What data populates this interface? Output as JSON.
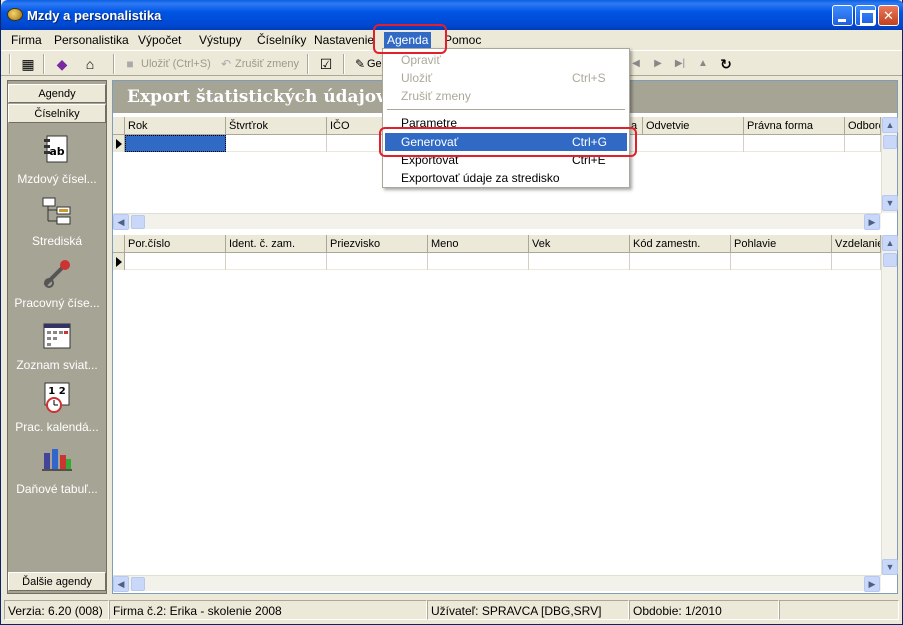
{
  "window": {
    "title": "Mzdy a personalistika"
  },
  "menubar": {
    "items": [
      {
        "label": "Firma"
      },
      {
        "label": "Personalistika"
      },
      {
        "label": "Výpočet"
      },
      {
        "label": "Výstupy"
      },
      {
        "label": "Číselníky"
      },
      {
        "label": "Nastavenie"
      },
      {
        "label": "Agenda"
      },
      {
        "label": "Pomoc"
      }
    ]
  },
  "toolbar": {
    "save_label": "Uložiť (Ctrl+S)",
    "cancel_label": "Zrušiť zmeny",
    "generate_label": "Ge"
  },
  "leftpane": {
    "tab_agendy": "Agendy",
    "tab_ciselniky": "Číselníky",
    "tab_dalsie": "Ďalšie agendy",
    "entries": [
      {
        "label": "Mzdový čísel...",
        "icon": "ab-book-icon"
      },
      {
        "label": "Strediská",
        "icon": "tree-structure-icon"
      },
      {
        "label": "Pracovný číse...",
        "icon": "wrench-icon"
      },
      {
        "label": "Zoznam sviat...",
        "icon": "calendar-icon"
      },
      {
        "label": "Prac. kalendá...",
        "icon": "calendar-clock-icon"
      },
      {
        "label": "Daňové tabuľ...",
        "icon": "bar-chart-icon"
      }
    ]
  },
  "content": {
    "banner": "Export štatistických údajov za",
    "grid1_headers": [
      "Rok",
      "Štvrťrok",
      "IČO",
      "",
      "",
      "a",
      "Odvetvie",
      "Právna forma",
      "Odborc"
    ],
    "grid2_headers": [
      "Por.číslo",
      "Ident. č. zam.",
      "Priezvisko",
      "Meno",
      "Vek",
      "Kód zamestn.",
      "Pohlavie",
      "Vzdelanie"
    ]
  },
  "dropdown": {
    "items": [
      {
        "label": "Opraviť",
        "shortcut": ""
      },
      {
        "label": "Uložiť",
        "shortcut": "Ctrl+S"
      },
      {
        "label": "Zrušiť zmeny",
        "shortcut": ""
      },
      {
        "label": "Parametre",
        "shortcut": ""
      },
      {
        "label": "Generovať",
        "shortcut": "Ctrl+G"
      },
      {
        "label": "Exportovať",
        "shortcut": "Ctrl+E"
      },
      {
        "label": "Exportovať údaje za stredisko",
        "shortcut": ""
      }
    ]
  },
  "statusbar": {
    "version": "Verzia: 6.20 (008)",
    "company": "Firma č.2: Erika - skolenie 2008",
    "user": "Užívateľ: SPRAVCA [DBG,SRV]",
    "period": "Obdobie: 1/2010"
  },
  "colors": {
    "highlight": "#316AC5",
    "annotation": "#E0202A",
    "titlebar": "#0055E5"
  }
}
